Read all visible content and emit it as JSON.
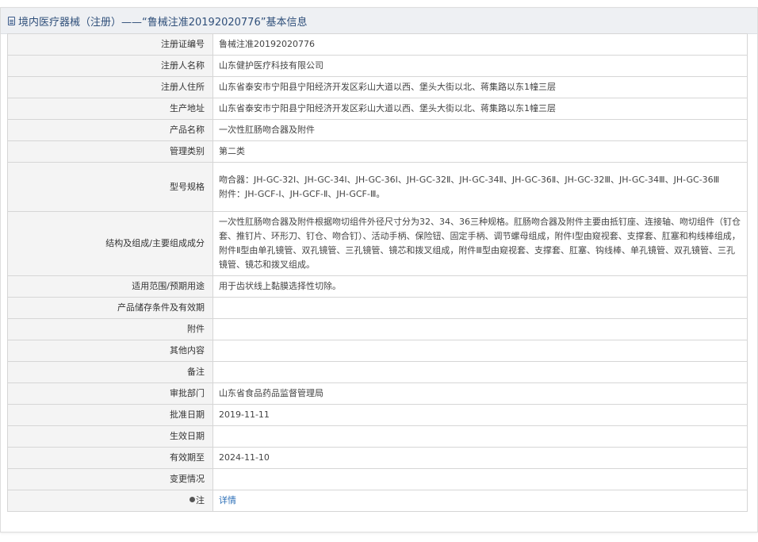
{
  "header": {
    "icon": "document-icon",
    "title": "境内医疗器械（注册）——“鲁械注准20192020776”基本信息"
  },
  "rows": [
    {
      "label": "注册证编号",
      "value": "鲁械注准20192020776"
    },
    {
      "label": "注册人名称",
      "value": "山东健护医疗科技有限公司"
    },
    {
      "label": "注册人住所",
      "value": "山东省泰安市宁阳县宁阳经济开发区彩山大道以西、堡头大街以北、蒋集路以东1幢三层"
    },
    {
      "label": "生产地址",
      "value": "山东省泰安市宁阳县宁阳经济开发区彩山大道以西、堡头大街以北、蒋集路以东1幢三层"
    },
    {
      "label": "产品名称",
      "value": "一次性肛肠吻合器及附件"
    },
    {
      "label": "管理类别",
      "value": "第二类"
    },
    {
      "label": "型号规格",
      "value_lines": [
        "吻合器：JH-GC-32Ⅰ、JH-GC-34Ⅰ、JH-GC-36Ⅰ、JH-GC-32Ⅱ、JH-GC-34Ⅱ、JH-GC-36Ⅱ、JH-GC-32Ⅲ、JH-GC-34Ⅲ、JH-GC-36Ⅲ",
        "附件：JH-GCF-Ⅰ、JH-GCF-Ⅱ、JH-GCF-Ⅲ。"
      ]
    },
    {
      "label": "结构及组成/主要组成成分",
      "value": "一次性肛肠吻合器及附件根据吻切组件外径尺寸分为32、34、36三种规格。肛肠吻合器及附件主要由抵钉座、连接轴、吻切组件（钉仓套、推钉片、环形刀、钉仓、吻合钉）、活动手柄、保险钮、固定手柄、调节螺母组成，附件Ⅰ型由窥视套、支撑套、肛塞和构线棒组成，附件Ⅱ型由单孔镜管、双孔镜管、三孔镜管、镜芯和拨叉组成，附件Ⅲ型由窥视套、支撑套、肛塞、钩线棒、单孔镜管、双孔镜管、三孔镜管、镜芯和拨叉组成。"
    },
    {
      "label": "适用范围/预期用途",
      "value": "用于齿状线上黏膜选择性切除。"
    },
    {
      "label": "产品储存条件及有效期",
      "value": ""
    },
    {
      "label": "附件",
      "value": ""
    },
    {
      "label": "其他内容",
      "value": ""
    },
    {
      "label": "备注",
      "value": ""
    },
    {
      "label": "审批部门",
      "value": "山东省食品药品监督管理局"
    },
    {
      "label": "批准日期",
      "value": "2019-11-11"
    },
    {
      "label": "生效日期",
      "value": ""
    },
    {
      "label": "有效期至",
      "value": "2024-11-10"
    },
    {
      "label": "变更情况",
      "value": ""
    },
    {
      "label": "注",
      "label_icon": "pin-icon",
      "link": "详情"
    }
  ],
  "colors": {
    "header_bg": "#eef0f3",
    "label_bg": "#f4f4f4",
    "link": "#2c6fb7",
    "title": "#2f4f7a"
  }
}
